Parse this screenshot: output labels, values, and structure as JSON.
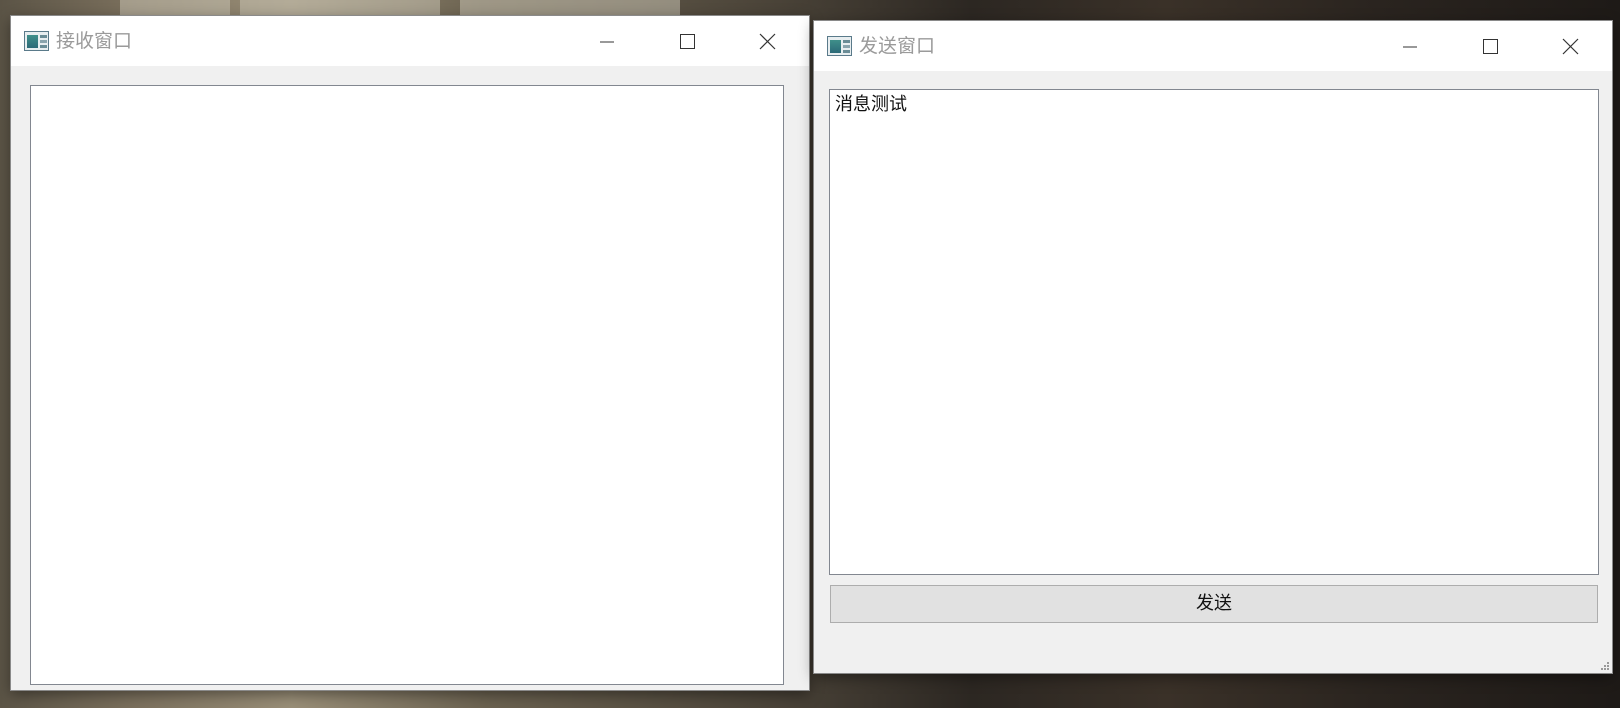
{
  "receive_window": {
    "title": "接收窗口",
    "icon": "app-window-icon",
    "controls": [
      "minimize-icon",
      "maximize-icon",
      "close-icon"
    ],
    "message_area": {
      "value": ""
    }
  },
  "send_window": {
    "title": "发送窗口",
    "icon": "app-window-icon",
    "controls": [
      "minimize-icon",
      "maximize-icon",
      "close-icon"
    ],
    "message_area": {
      "value": "消息测试"
    },
    "send_button": {
      "label": "发送"
    }
  }
}
